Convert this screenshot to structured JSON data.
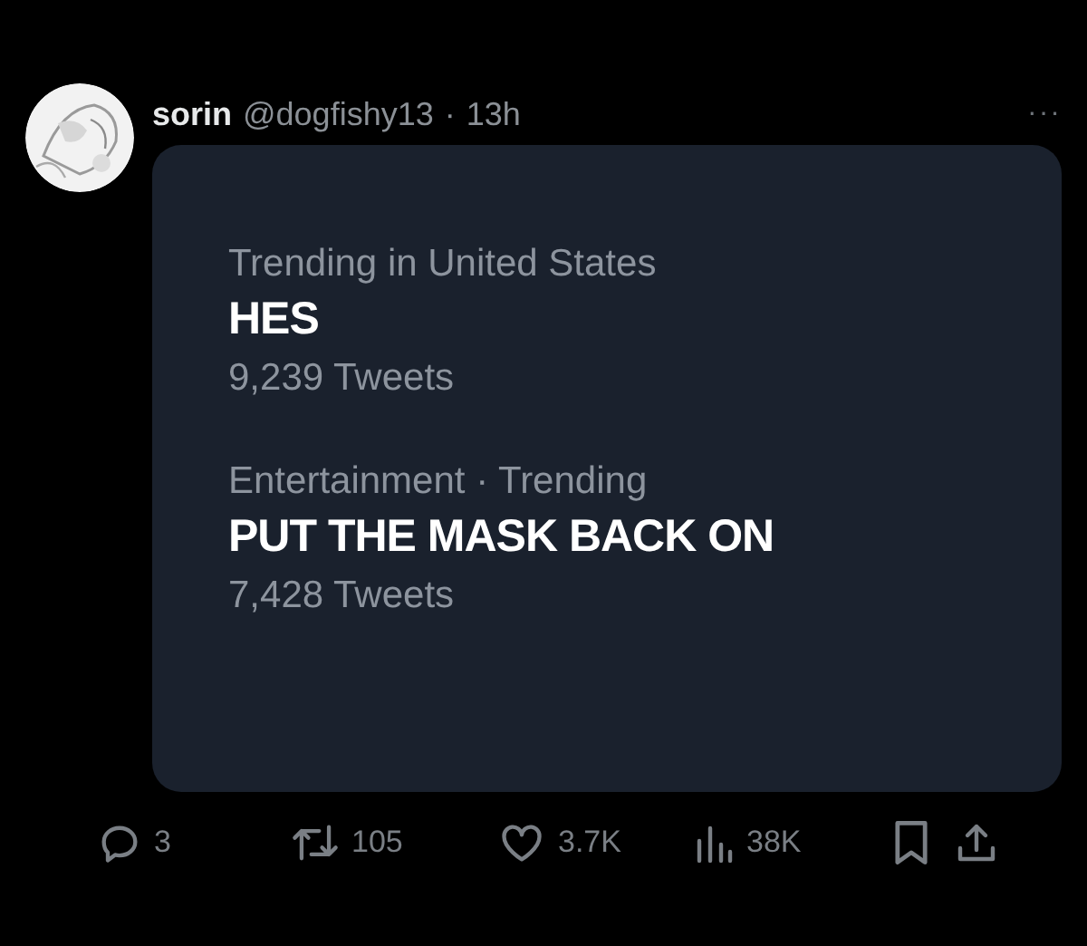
{
  "tweet": {
    "name": "sorin",
    "handle": "@dogfishy13",
    "separator": "·",
    "time": "13h",
    "more": "···"
  },
  "image": {
    "trends": [
      {
        "context": "Trending in United States",
        "topic": "HES",
        "count": "9,239 Tweets"
      },
      {
        "context": "Entertainment · Trending",
        "topic": "PUT THE MASK BACK ON",
        "count": "7,428 Tweets"
      }
    ]
  },
  "actions": [
    {
      "kind": "reply",
      "count": "3"
    },
    {
      "kind": "retweet",
      "count": "105"
    },
    {
      "kind": "like",
      "count": "3.7K"
    },
    {
      "kind": "views",
      "count": "38K"
    },
    {
      "kind": "bookmark"
    },
    {
      "kind": "share"
    }
  ]
}
